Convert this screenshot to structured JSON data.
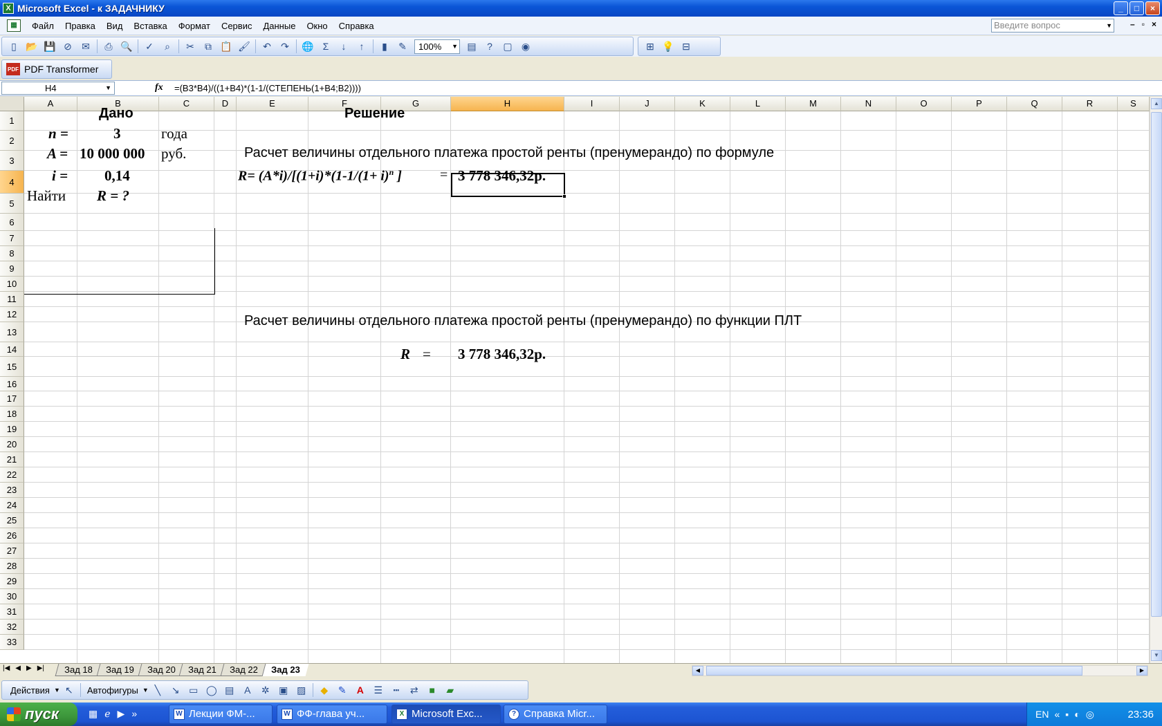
{
  "window": {
    "title": "Microsoft Excel - к ЗАДАЧНИКУ",
    "min": "_",
    "max": "□",
    "close": "×"
  },
  "menu": {
    "items": [
      "Файл",
      "Правка",
      "Вид",
      "Вставка",
      "Формат",
      "Сервис",
      "Данные",
      "Окно",
      "Справка"
    ],
    "help_placeholder": "Введите вопрос",
    "doc_min": "–",
    "doc_restore": "▫",
    "doc_close": "×"
  },
  "toolbar": {
    "zoom": "100%",
    "sigma": "Σ",
    "pdf_label": "PDF Transformer",
    "pdf_icon_text": "PDF"
  },
  "formula_bar": {
    "name_box": "H4",
    "fx": "fx",
    "formula": "=(B3*B4)/((1+B4)*(1-1/(СТЕПЕНЬ(1+B4;B2))))"
  },
  "columns": [
    "A",
    "B",
    "C",
    "D",
    "E",
    "F",
    "G",
    "H",
    "I",
    "J",
    "K",
    "L",
    "M",
    "N",
    "O",
    "P",
    "Q",
    "R",
    "S"
  ],
  "selected_column": "H",
  "rows": [
    "1",
    "2",
    "3",
    "4",
    "5",
    "6",
    "7",
    "8",
    "9",
    "10",
    "11",
    "12",
    "13",
    "14",
    "15",
    "16",
    "17",
    "18",
    "19",
    "20",
    "21",
    "22",
    "23",
    "24",
    "25",
    "26",
    "27",
    "28",
    "29",
    "30",
    "31",
    "32",
    "33"
  ],
  "selected_row": "4",
  "cells": {
    "given_header": "Дано",
    "solution_header": "Решение",
    "n_label": "n =",
    "n_value": "3",
    "n_unit": "года",
    "a_label": "A =",
    "a_value": "10 000 000",
    "a_unit": "руб.",
    "i_label": "i =",
    "i_value": "0,14",
    "find_label": "Найти",
    "find_value": "R = ?",
    "formula_caption": "Расчет величины отдельного платежа простой ренты (пренумерандо) по формуле",
    "formula_text": "R= (A*i)/[(1+i)*(1-1/(1+ i)",
    "formula_sup": "n",
    "formula_end": "]",
    "formula_eq": "=",
    "result1": "3 778 346,32р.",
    "plt_caption": "Расчет величины отдельного платежа простой ренты (пренумерандо) по функции ПЛТ",
    "r_label": "R",
    "r_eq": "=",
    "result2": "3 778 346,32р."
  },
  "sheet_tabs": [
    "Зад 18",
    "Зад 19",
    "Зад 20",
    "Зад 21",
    "Зад 22",
    "Зад 23"
  ],
  "active_tab": "Зад 23",
  "draw_toolbar": {
    "actions": "Действия",
    "autoshapes": "Автофигуры"
  },
  "taskbar": {
    "start": "пуск",
    "tasks": [
      "Лекции ФМ-...",
      "ФФ-глава уч...",
      "Microsoft Exc...",
      "Справка Micr..."
    ],
    "lang": "EN",
    "time": "23:36"
  }
}
